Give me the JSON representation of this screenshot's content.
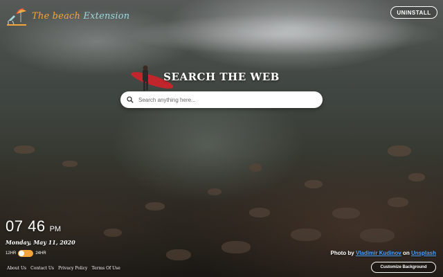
{
  "header": {
    "logo_text_1": "The beach",
    "logo_text_2": "Extension",
    "uninstall_label": "UNINSTALL"
  },
  "search": {
    "title": "SEARCH THE WEB",
    "placeholder": "Search anything here..."
  },
  "clock": {
    "time": "07 46",
    "ampm": "PM",
    "date": "Monday, May 11, 2020",
    "format_12": "12HR",
    "format_24": "24HR"
  },
  "footer": {
    "links": [
      "About Us",
      "Contact Us",
      "Privacy Policy",
      "Terms Of Use"
    ],
    "credit_prefix": "Photo by",
    "credit_author": "Vladimir Kudinov",
    "credit_on": "on",
    "credit_site": "Unsplash",
    "customize_label": "Customize Background"
  },
  "colors": {
    "accent": "#f3a53b",
    "link": "#4fa3ff"
  }
}
